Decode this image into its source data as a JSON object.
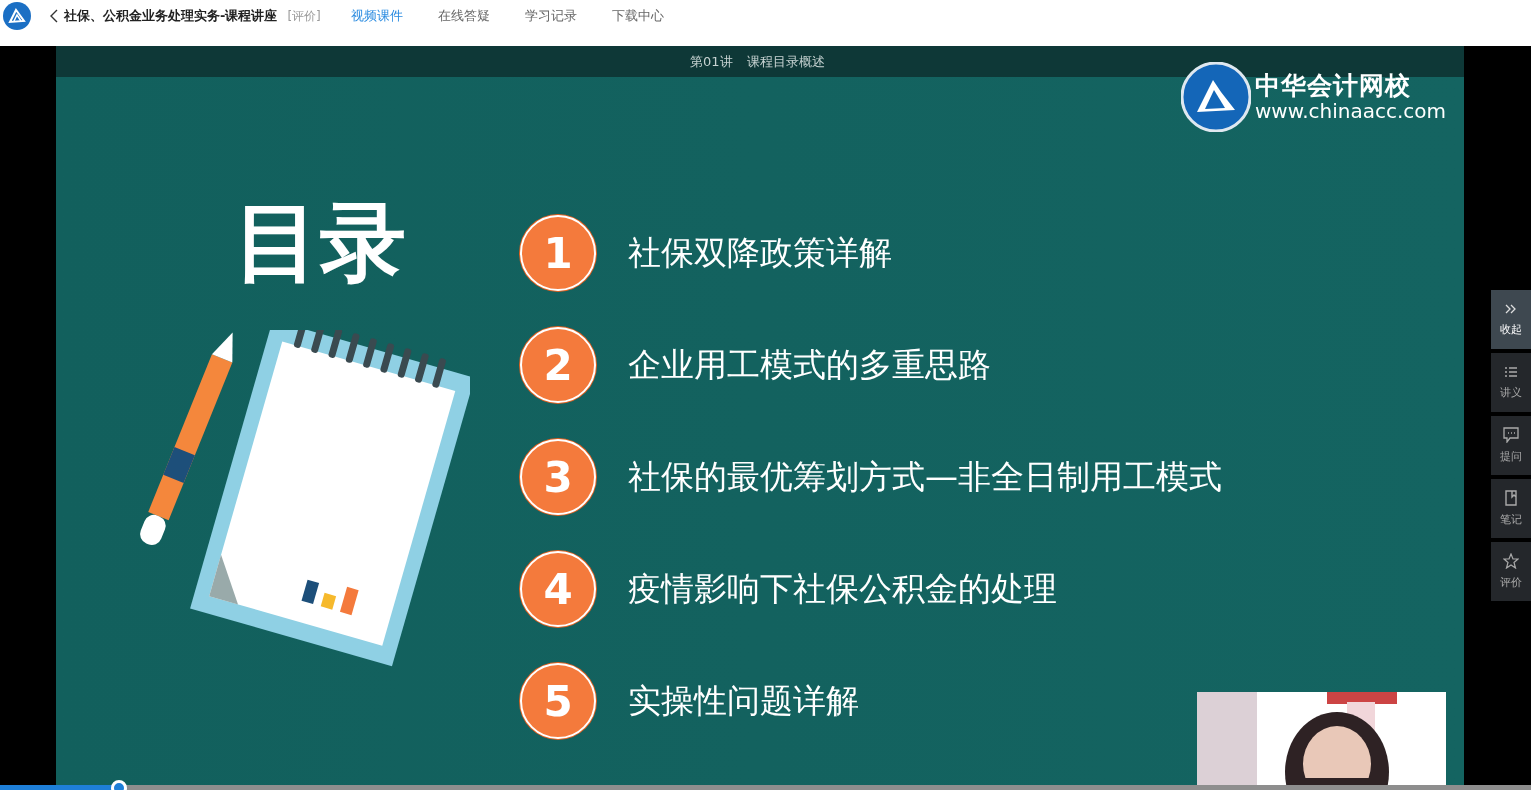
{
  "app_bar": {
    "course_title": "社保、公积金业务处理实务-课程讲座",
    "rate_link": "[评价]",
    "tabs": [
      {
        "label": "视频课件",
        "selected": true
      },
      {
        "label": "在线答疑",
        "selected": false
      },
      {
        "label": "学习记录",
        "selected": false
      },
      {
        "label": "下载中心",
        "selected": false
      }
    ]
  },
  "video": {
    "lecture_number": "第01讲",
    "lecture_title": "课程目录概述",
    "slide": {
      "logo_name": "中华会计网校",
      "logo_url": "www.chinaacc.com",
      "heading": "目录",
      "items": [
        {
          "number": "1",
          "text": "社保双降政策详解"
        },
        {
          "number": "2",
          "text": "企业用工模式的多重思路"
        },
        {
          "number": "3",
          "text": "社保的最优筹划方式—非全日制用工模式"
        },
        {
          "number": "4",
          "text": "疫情影响下社保公积金的处理"
        },
        {
          "number": "5",
          "text": "实操性问题详解"
        }
      ]
    },
    "progress": {
      "level": 0.078
    }
  },
  "side_panel": [
    {
      "label": "收起",
      "kind": "collapse"
    },
    {
      "label": "讲义",
      "kind": "handout"
    },
    {
      "label": "提问",
      "kind": "question"
    },
    {
      "label": "笔记",
      "kind": "notes"
    },
    {
      "label": "评价",
      "kind": "rating"
    }
  ]
}
